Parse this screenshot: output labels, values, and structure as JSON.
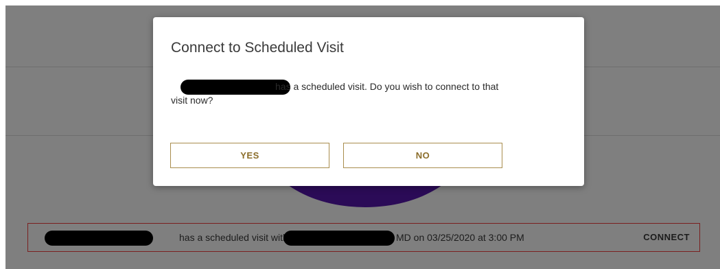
{
  "background": {
    "overlay_color": "#7f7f7f",
    "accent_purple": "#2b0b57"
  },
  "banner": {
    "text_part1": "has a scheduled visit with",
    "text_part2": "MD on 03/25/2020 at 3:00 PM",
    "connect_label": "CONNECT",
    "border_color": "#7a1f1f"
  },
  "modal": {
    "title": "Connect to Scheduled Visit",
    "body_line1": "has a scheduled visit. Do you wish to connect to that",
    "body_line2": "visit now?",
    "yes_label": "YES",
    "no_label": "NO",
    "button_color": "#8b6d2a"
  }
}
